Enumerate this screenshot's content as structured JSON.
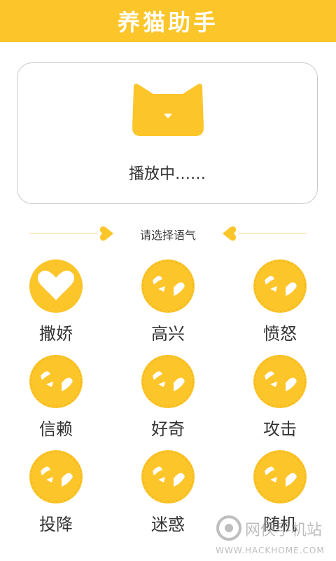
{
  "header": {
    "title": "养猫助手"
  },
  "player": {
    "icon": "cat-face-icon",
    "status": "播放中……"
  },
  "section": {
    "label": "请选择语气",
    "icon": "heart-icon"
  },
  "moods": [
    {
      "label": "撒娇",
      "icon": "heart-icon"
    },
    {
      "label": "高兴",
      "icon": "cat-mood-icon"
    },
    {
      "label": "愤怒",
      "icon": "cat-mood-icon"
    },
    {
      "label": "信赖",
      "icon": "cat-mood-icon"
    },
    {
      "label": "好奇",
      "icon": "cat-mood-icon"
    },
    {
      "label": "攻击",
      "icon": "cat-mood-icon"
    },
    {
      "label": "投降",
      "icon": "cat-mood-icon"
    },
    {
      "label": "迷惑",
      "icon": "cat-mood-icon"
    },
    {
      "label": "随机",
      "icon": "cat-mood-icon"
    }
  ],
  "watermark": {
    "name": "网侠手机站",
    "url": "WWW.HACKHOME.COM"
  },
  "colors": {
    "accent": "#fcc52a",
    "border": "#c9c9c9",
    "text": "#333333"
  }
}
